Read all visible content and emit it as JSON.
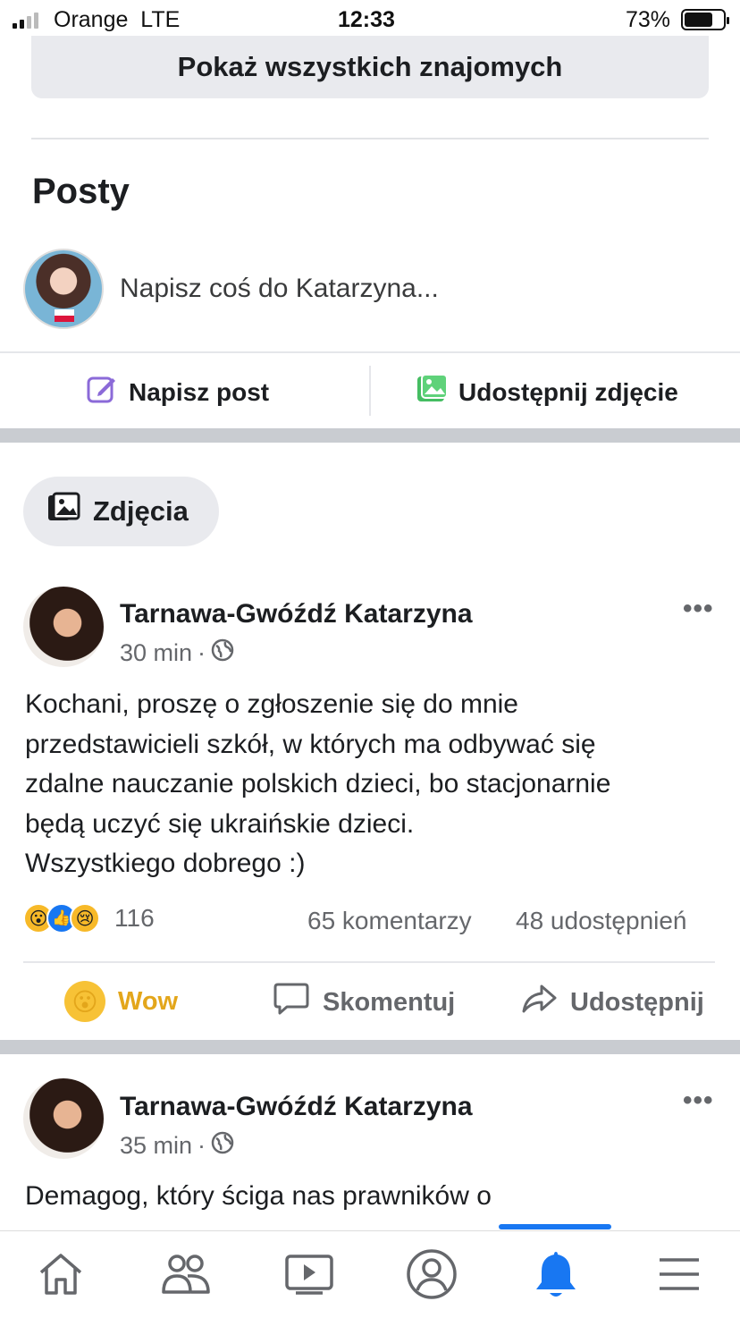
{
  "status_bar": {
    "carrier": "Orange",
    "network": "LTE",
    "time": "12:33",
    "battery_percent": "73%",
    "battery_level": 0.73
  },
  "friends": {
    "show_all_label": "Pokaż wszystkich znajomych"
  },
  "posts_section": {
    "title": "Posty",
    "composer_placeholder": "Napisz coś do Katarzyna...",
    "write_post_label": "Napisz post",
    "share_photo_label": "Udostępnij zdjęcie"
  },
  "photos_pill": {
    "label": "Zdjęcia"
  },
  "posts": [
    {
      "author": "Tarnawa-Gwóźdź Katarzyna",
      "time": "30 min",
      "separator": "·",
      "text_lines": [
        "Kochani, proszę o zgłoszenie się do mnie",
        "przedstawicieli szkół, w których ma odbywać się",
        "zdalne nauczanie polskich dzieci, bo stacjonarnie",
        "będą uczyć się ukraińskie dzieci.",
        "Wszystkiego dobrego :)"
      ],
      "reaction_count": "116",
      "comments": "65 komentarzy",
      "shares": "48 udostępnień",
      "actions": {
        "wow": "Wow",
        "comment": "Skomentuj",
        "share": "Udostępnij"
      }
    },
    {
      "author": "Tarnawa-Gwóźdź Katarzyna",
      "time": "35 min",
      "separator": "·",
      "text_lines": [
        "Demagog, który ściga nas prawników o"
      ]
    }
  ],
  "colors": {
    "accent": "#1877f2",
    "wow": "#e3a61b",
    "pill_bg": "#e9eaee"
  },
  "icons": {
    "tabs": [
      "home-icon",
      "friends-icon",
      "video-icon",
      "profile-icon",
      "bell-icon",
      "menu-icon"
    ]
  }
}
